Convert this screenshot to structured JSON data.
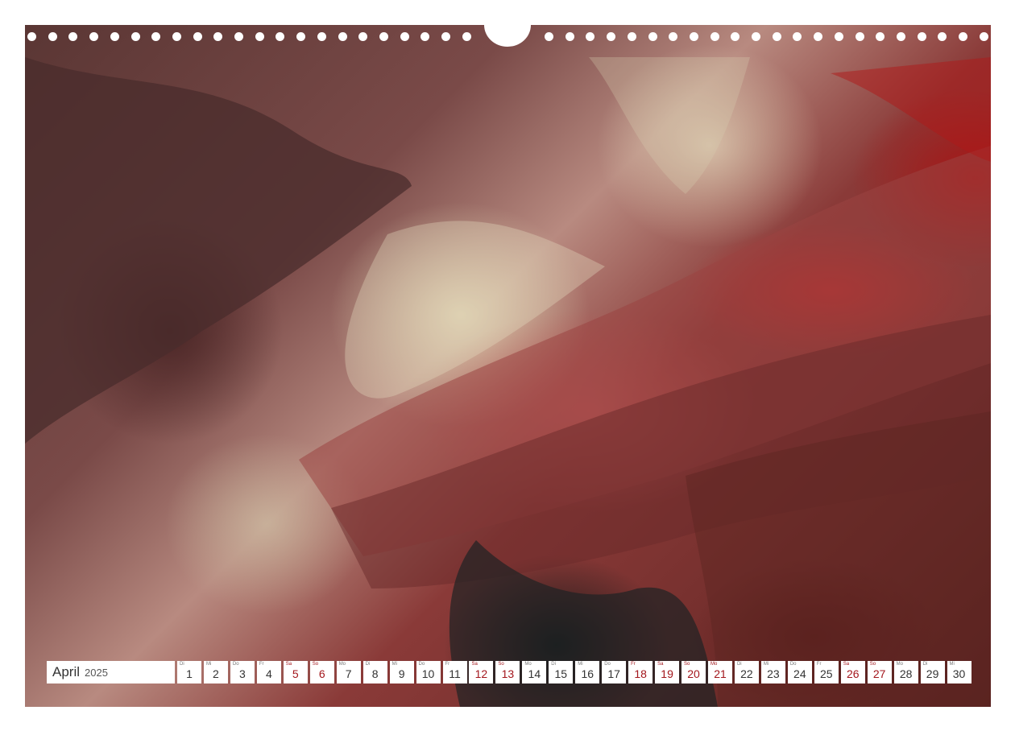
{
  "calendar": {
    "month": "April",
    "year": "2025",
    "days": [
      {
        "abbr": "Di",
        "num": "1",
        "weekend": false
      },
      {
        "abbr": "Mi",
        "num": "2",
        "weekend": false
      },
      {
        "abbr": "Do",
        "num": "3",
        "weekend": false
      },
      {
        "abbr": "Fr",
        "num": "4",
        "weekend": false
      },
      {
        "abbr": "Sa",
        "num": "5",
        "weekend": true
      },
      {
        "abbr": "So",
        "num": "6",
        "weekend": true
      },
      {
        "abbr": "Mo",
        "num": "7",
        "weekend": false
      },
      {
        "abbr": "Di",
        "num": "8",
        "weekend": false
      },
      {
        "abbr": "Mi",
        "num": "9",
        "weekend": false
      },
      {
        "abbr": "Do",
        "num": "10",
        "weekend": false
      },
      {
        "abbr": "Fr",
        "num": "11",
        "weekend": false
      },
      {
        "abbr": "Sa",
        "num": "12",
        "weekend": true
      },
      {
        "abbr": "So",
        "num": "13",
        "weekend": true
      },
      {
        "abbr": "Mo",
        "num": "14",
        "weekend": false
      },
      {
        "abbr": "Di",
        "num": "15",
        "weekend": false
      },
      {
        "abbr": "Mi",
        "num": "16",
        "weekend": false
      },
      {
        "abbr": "Do",
        "num": "17",
        "weekend": false
      },
      {
        "abbr": "Fr",
        "num": "18",
        "weekend": true
      },
      {
        "abbr": "Sa",
        "num": "19",
        "weekend": true
      },
      {
        "abbr": "So",
        "num": "20",
        "weekend": true
      },
      {
        "abbr": "Mo",
        "num": "21",
        "weekend": true
      },
      {
        "abbr": "Di",
        "num": "22",
        "weekend": false
      },
      {
        "abbr": "Mi",
        "num": "23",
        "weekend": false
      },
      {
        "abbr": "Do",
        "num": "24",
        "weekend": false
      },
      {
        "abbr": "Fr",
        "num": "25",
        "weekend": false
      },
      {
        "abbr": "Sa",
        "num": "26",
        "weekend": true
      },
      {
        "abbr": "So",
        "num": "27",
        "weekend": true
      },
      {
        "abbr": "Mo",
        "num": "28",
        "weekend": false
      },
      {
        "abbr": "Di",
        "num": "29",
        "weekend": false
      },
      {
        "abbr": "Mi",
        "num": "30",
        "weekend": false
      }
    ]
  },
  "colors": {
    "weekend": "#a3161c",
    "weekday": "#333333"
  }
}
